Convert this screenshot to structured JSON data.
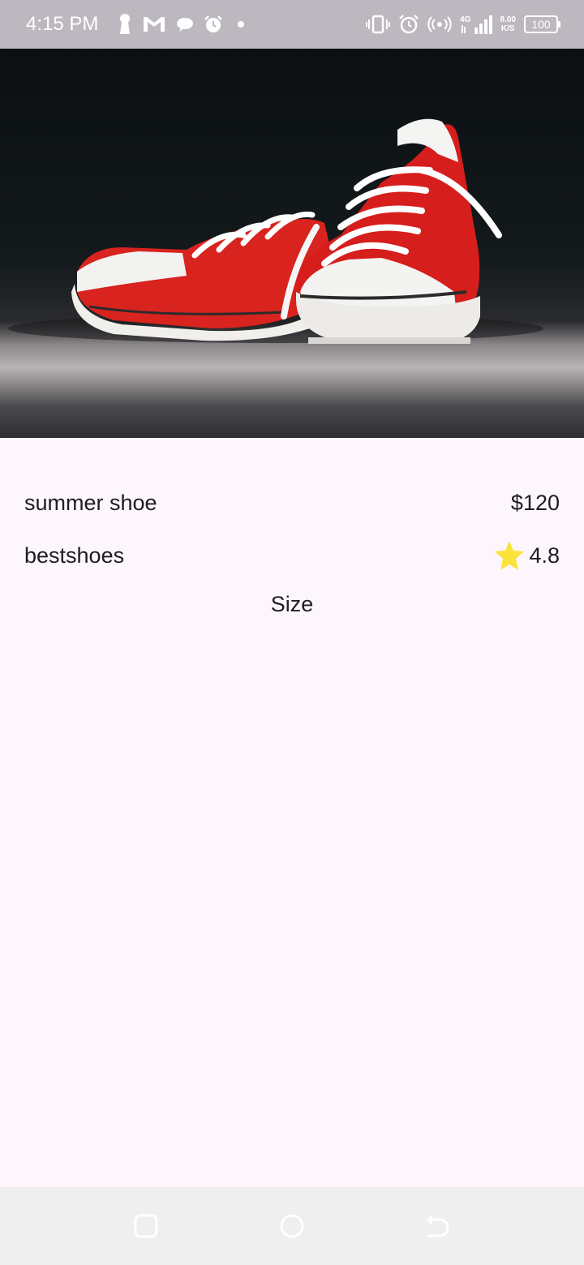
{
  "status_bar": {
    "time": "4:15 PM",
    "network_type": "4G",
    "net_speed_value": "8.00",
    "net_speed_unit": "K/S",
    "battery": "100",
    "icons": [
      "keyhole-icon",
      "gmail-icon",
      "chat-bubble-icon",
      "alarm-icon",
      "dot-icon",
      "vibrate-icon",
      "alarm-icon",
      "hotspot-icon",
      "signal-icon",
      "battery-icon"
    ]
  },
  "product": {
    "image_alt": "red sneakers",
    "name": "summer shoe",
    "price": "$120",
    "brand": "bestshoes",
    "rating": "4.8",
    "size_label": "Size"
  },
  "colors": {
    "background": "#fdf7fd",
    "status_bar": "#bdb8bf",
    "star": "#fbe43a",
    "nav_bar": "#efefef"
  },
  "nav_bar": {
    "buttons": [
      "recents-button",
      "home-button",
      "back-button"
    ]
  }
}
